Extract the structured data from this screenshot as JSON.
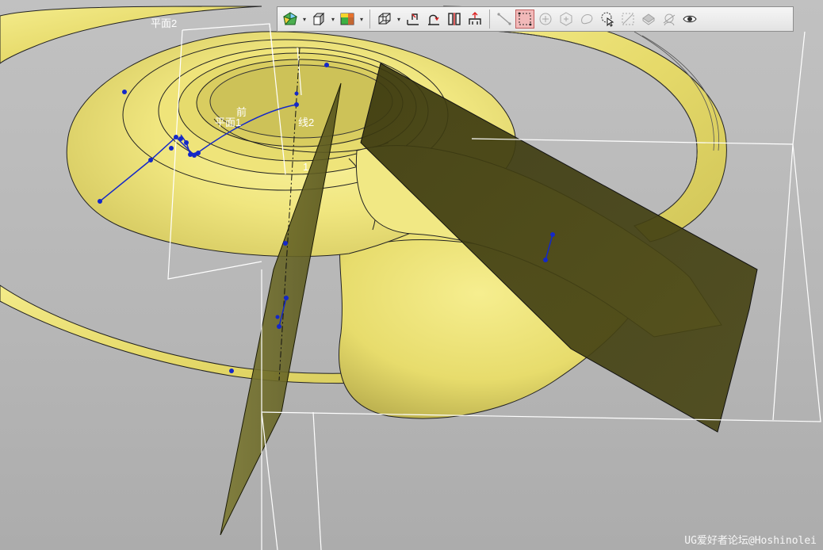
{
  "viewport": {
    "labels": {
      "plane2": "平面2",
      "front": "前",
      "plane1": "平面1",
      "line2": "线2",
      "marker": "1"
    },
    "watermark": "UG爱好者论坛@Hoshinolei"
  },
  "toolbar": {
    "groups": [
      [
        "render-style-icon",
        "view-orient-icon",
        "shaded-icon"
      ],
      [
        "wireframe-icon",
        "section-icon",
        "rotate-icon",
        "split-icon",
        "move-icon"
      ],
      [
        "line-icon",
        "select-rect-icon",
        "snap-center-icon",
        "snap-quad-icon",
        "lasso-icon",
        "select-pointer-icon",
        "clip-icon",
        "surface-icon",
        "hide-icon",
        "show-icon"
      ]
    ],
    "active_button": "select-rect-icon"
  },
  "colors": {
    "part_light": "#f3ec8a",
    "part_mid": "#e0d567",
    "part_dark": "#3d3b10",
    "plane_face": "#6b6a28",
    "curve_blue": "#1428c8",
    "plane_frame": "#ffffff",
    "background": "#b9b9b9"
  }
}
